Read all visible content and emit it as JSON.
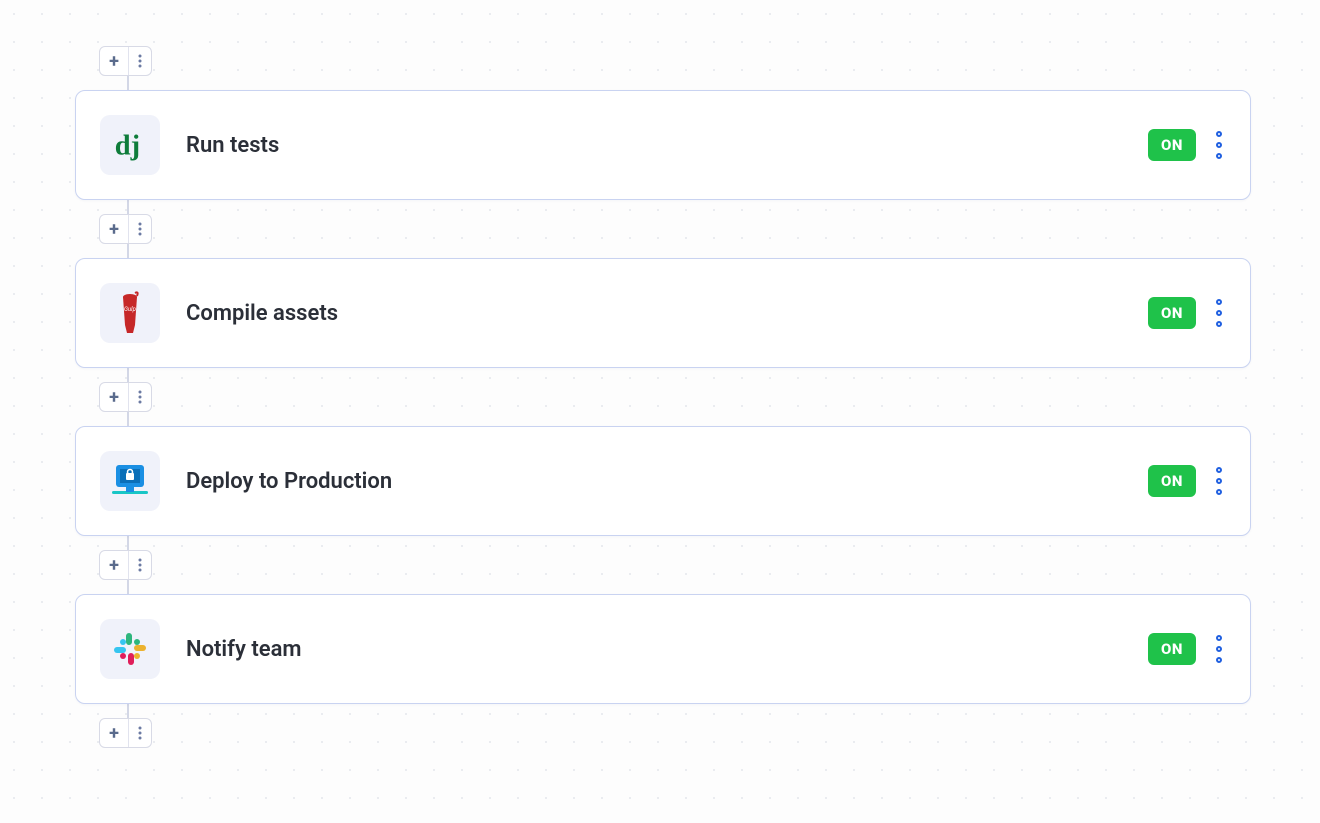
{
  "toggle_label": "ON",
  "steps": [
    {
      "title": "Run tests",
      "icon": "django"
    },
    {
      "title": "Compile assets",
      "icon": "gulp"
    },
    {
      "title": "Deploy to Production",
      "icon": "deploy"
    },
    {
      "title": "Notify team",
      "icon": "slack"
    }
  ]
}
